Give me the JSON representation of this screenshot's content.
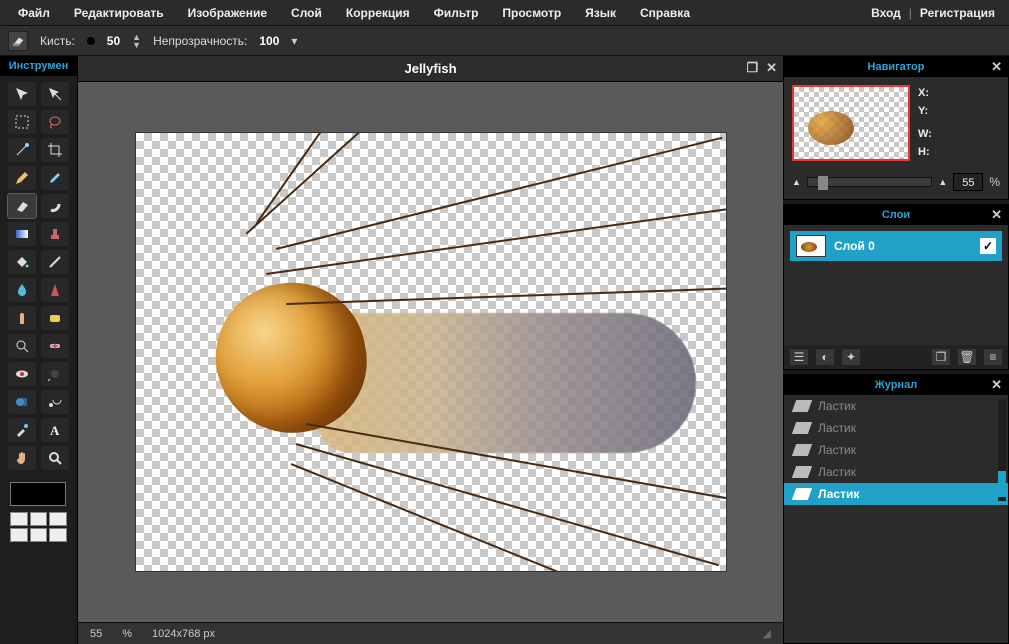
{
  "menu": {
    "file": "Файл",
    "edit": "Редактировать",
    "image": "Изображение",
    "layer": "Слой",
    "adjust": "Коррекция",
    "filter": "Фильтр",
    "view": "Просмотр",
    "lang": "Язык",
    "help": "Справка"
  },
  "auth": {
    "login": "Вход",
    "register": "Регистрация"
  },
  "options": {
    "brush_label": "Кисть:",
    "brush_size": "50",
    "opacity_label": "Непрозрачность:",
    "opacity_value": "100"
  },
  "tools_panel_title": "Инструмен",
  "document": {
    "title": "Jellyfish"
  },
  "status": {
    "zoom": "55",
    "zoom_pct": "%",
    "dims": "1024x768 px"
  },
  "navigator": {
    "title": "Навигатор",
    "x": "X:",
    "y": "Y:",
    "w": "W:",
    "h": "H:",
    "zoom": "55",
    "pct": "%"
  },
  "layers": {
    "title": "Слои",
    "items": [
      {
        "name": "Слой 0",
        "visible": true
      }
    ]
  },
  "history": {
    "title": "Журнал",
    "items": [
      {
        "label": "Ластик",
        "active": false
      },
      {
        "label": "Ластик",
        "active": false
      },
      {
        "label": "Ластик",
        "active": false
      },
      {
        "label": "Ластик",
        "active": false
      },
      {
        "label": "Ластик",
        "active": true
      }
    ]
  },
  "tool_names": [
    "move",
    "transform",
    "marquee",
    "lasso",
    "wand",
    "crop",
    "pencil",
    "brush",
    "eraser",
    "smudge",
    "gradient",
    "stamp",
    "paint-bucket",
    "line",
    "blur",
    "sharpen",
    "finger",
    "sponge",
    "magnify",
    "heal",
    "redeye",
    "dodge",
    "shape",
    "burn",
    "color-picker",
    "type",
    "hand",
    "zoom"
  ]
}
